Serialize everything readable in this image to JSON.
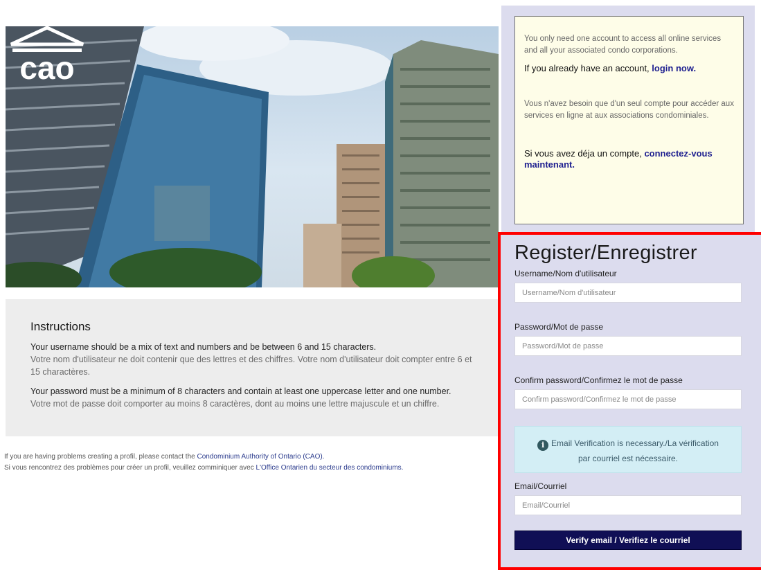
{
  "brand": {
    "logo_text": "cao"
  },
  "info": {
    "en_text": "You only need one account to access all online services and all your associated condo corporations.",
    "en_login_prefix": "If you already have an account, ",
    "en_login_link": "login now.",
    "fr_text": "Vous n'avez besoin que d'un seul compte pour accéder aux services en ligne at aux associations condominiales.",
    "fr_login_prefix": "Si vous avez déja un compte, ",
    "fr_login_link": "connectez-vous maintenant."
  },
  "instructions": {
    "title": "Instructions",
    "username_en": "Your username should be a mix of text and numbers and be between 6 and 15 characters.",
    "username_fr": "Votre nom d'utilisateur ne doit contenir que des lettres et des chiffres. Votre nom d'utilisateur doit compter entre 6 et 15 charactères.",
    "password_en": "Your password must be a minimum of 8 characters and contain at least one uppercase letter and one number.",
    "password_fr": "Votre mot de passe doit comporter au moins 8 caractères, dont au moins une lettre majuscule et un chiffre."
  },
  "help": {
    "line1_prefix": "If you are having problems creating a profil, please contact the ",
    "line1_link": "Condominium Authority of Ontario (CAO).",
    "line2_prefix": "Si vous rencontrez des problèmes pour créer un profil, veuillez comminiquer avec ",
    "line2_link": "L'Office Ontarien du secteur des condominiums."
  },
  "register": {
    "title": "Register/Enregistrer",
    "username_label": "Username/Nom d'utilisateur",
    "username_placeholder": "Username/Nom d'utilisateur",
    "password_label": "Password/Mot de passe",
    "password_placeholder": "Password/Mot de passe",
    "confirm_label": "Confirm password/Confirmez le mot de passe",
    "confirm_placeholder": "Confirm password/Confirmez le mot de passe",
    "notice_line1": "Email Verification is necessary./La vérification",
    "notice_line2": "par courriel est nécessaire.",
    "email_label": "Email/Courriel",
    "email_placeholder": "Email/Courriel",
    "verify_button": "Verify email / Verifiez le courriel"
  },
  "colors": {
    "panel": "#dcdcee",
    "highlight_border": "#ff0000",
    "button": "#100f55",
    "notice_bg": "#d3eef5",
    "info_bg": "#fefde8",
    "link": "#1e1f8f"
  }
}
